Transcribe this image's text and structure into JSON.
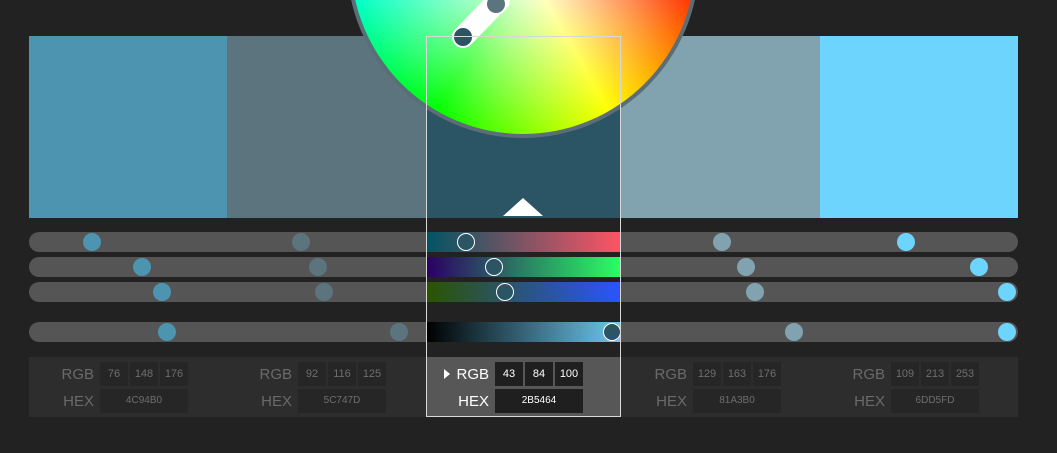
{
  "colors": [
    {
      "hex": "#4c94b0",
      "rgb": {
        "r": "76",
        "g": "148",
        "b": "176"
      },
      "hex_label": "4C94B0"
    },
    {
      "hex": "#5c747d",
      "rgb": {
        "r": "92",
        "g": "116",
        "b": "125"
      },
      "hex_label": "5C747D"
    },
    {
      "hex": "#2b5464",
      "rgb": {
        "r": "43",
        "g": "84",
        "b": "100"
      },
      "hex_label": "2B5464"
    },
    {
      "hex": "#81a3b0",
      "rgb": {
        "r": "129",
        "g": "163",
        "b": "176"
      },
      "hex_label": "81A3B0"
    },
    {
      "hex": "#6dd5fd",
      "rgb": {
        "r": "109",
        "g": "213",
        "b": "253"
      },
      "hex_label": "6DD5FD"
    }
  ],
  "labels": {
    "rgb": "RGB",
    "hex": "HEX"
  },
  "active_index": 2,
  "ui_colors": {
    "background": "#222222",
    "track": "#555555",
    "panel": "#2d2d2d",
    "active_panel": "#575757",
    "highlight": "#d8d8d8"
  }
}
